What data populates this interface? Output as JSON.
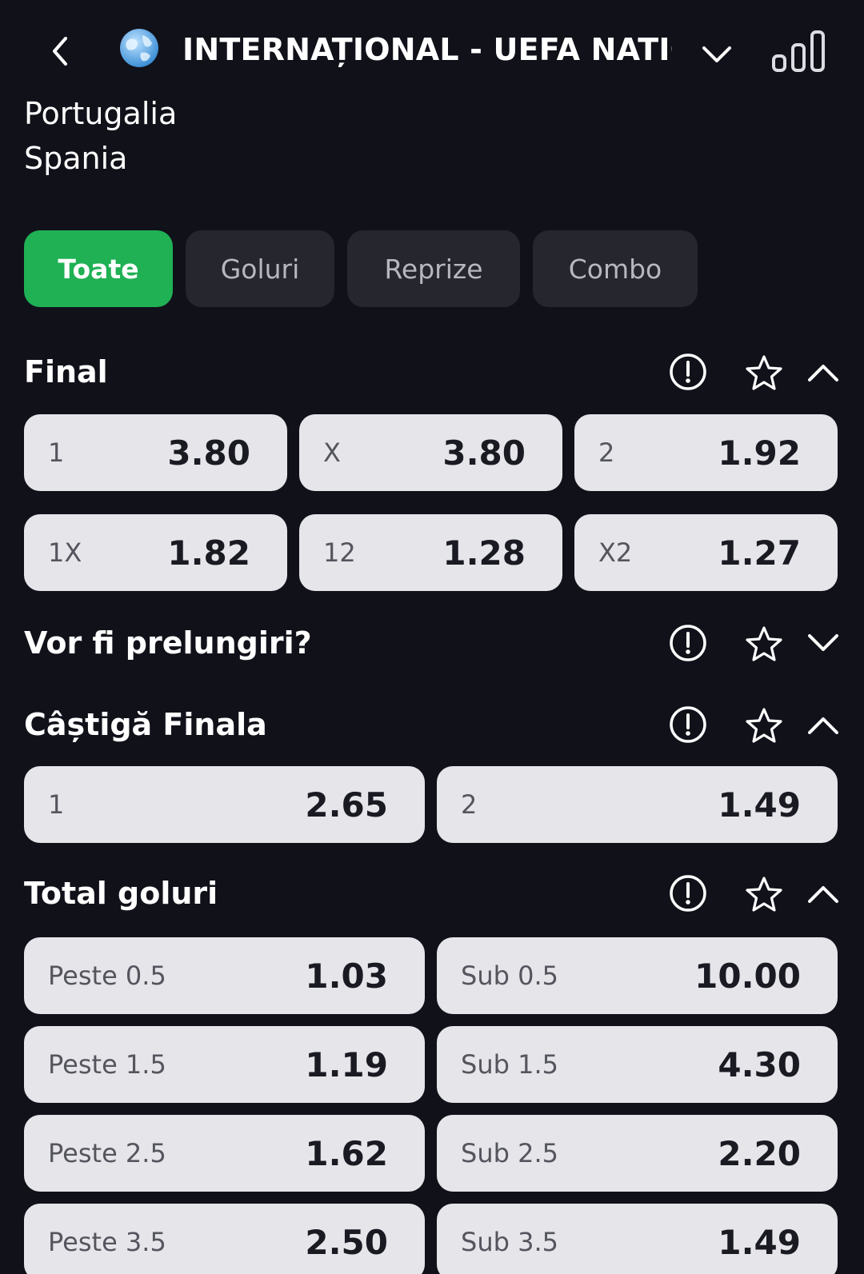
{
  "header": {
    "title": "INTERNAȚIONAL - UEFA NATIO...",
    "back_icon": "chevron-left-icon",
    "flag_icon": "globe-icon",
    "expand_icon": "chevron-down-icon",
    "stats_icon": "stats-bars-icon"
  },
  "match": {
    "home": "Portugalia",
    "away": "Spania"
  },
  "tabs": [
    {
      "label": "Toate",
      "active": true
    },
    {
      "label": "Goluri",
      "active": false
    },
    {
      "label": "Reprize",
      "active": false
    },
    {
      "label": "Combo",
      "active": false
    }
  ],
  "sections": {
    "final": {
      "title": "Final",
      "odds": [
        {
          "label": "1",
          "value": "3.80"
        },
        {
          "label": "X",
          "value": "3.80"
        },
        {
          "label": "2",
          "value": "1.92"
        },
        {
          "label": "1X",
          "value": "1.82"
        },
        {
          "label": "12",
          "value": "1.28"
        },
        {
          "label": "X2",
          "value": "1.27"
        }
      ]
    },
    "extra_time": {
      "title": "Vor fi prelungiri?"
    },
    "win_final": {
      "title": "Câștigă Finala",
      "odds": [
        {
          "label": "1",
          "value": "2.65"
        },
        {
          "label": "2",
          "value": "1.49"
        }
      ]
    },
    "total_goals": {
      "title": "Total goluri",
      "odds": [
        {
          "label": "Peste 0.5",
          "value": "1.03"
        },
        {
          "label": "Sub 0.5",
          "value": "10.00"
        },
        {
          "label": "Peste 1.5",
          "value": "1.19"
        },
        {
          "label": "Sub 1.5",
          "value": "4.30"
        },
        {
          "label": "Peste 2.5",
          "value": "1.62"
        },
        {
          "label": "Sub 2.5",
          "value": "2.20"
        },
        {
          "label": "Peste 3.5",
          "value": "2.50"
        },
        {
          "label": "Sub 3.5",
          "value": "1.49"
        }
      ]
    }
  },
  "colors": {
    "background": "#11111a",
    "accent": "#1fb154",
    "tab_inactive": "#26262e",
    "odds_button": "#e5e5ea"
  }
}
